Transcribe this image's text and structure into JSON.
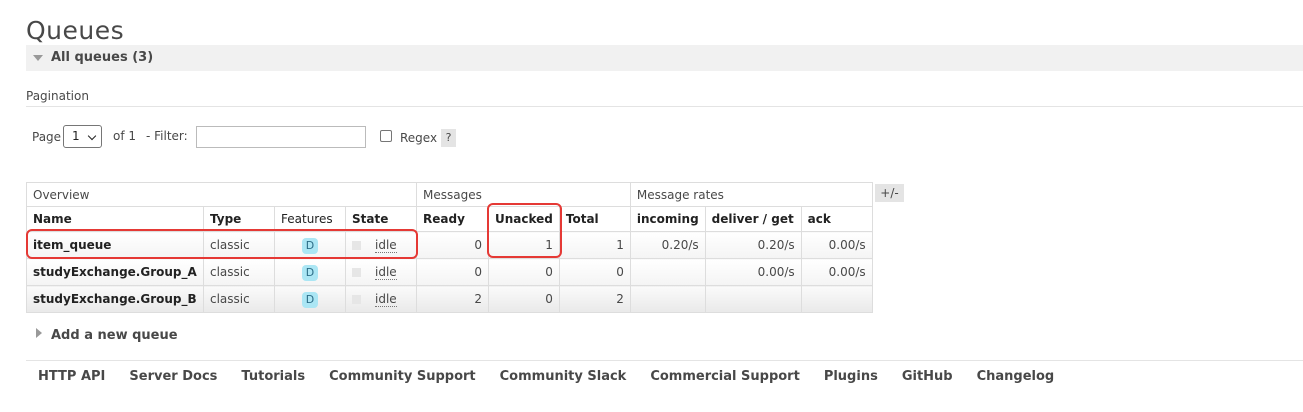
{
  "page": {
    "title": "Queues"
  },
  "section": {
    "label": "All queues (3)"
  },
  "pagination": {
    "label": "Pagination",
    "page_label": "Page",
    "page_value": "1",
    "of_label": "of 1",
    "filter_label": "- Filter:",
    "filter_value": "",
    "regex_label": "Regex",
    "help_label": "?"
  },
  "table": {
    "groups": {
      "overview": "Overview",
      "messages": "Messages",
      "rates": "Message rates"
    },
    "columns": {
      "name": "Name",
      "type": "Type",
      "features": "Features",
      "state": "State",
      "ready": "Ready",
      "unacked": "Unacked",
      "total": "Total",
      "incoming": "incoming",
      "deliver": "deliver / get",
      "ack": "ack"
    },
    "toggle": "+/-",
    "rows": [
      {
        "name": "item_queue",
        "type": "classic",
        "feature": "D",
        "state": "idle",
        "ready": "0",
        "unacked": "1",
        "total": "1",
        "incoming": "0.20/s",
        "deliver": "0.20/s",
        "ack": "0.00/s"
      },
      {
        "name": "studyExchange.Group_A",
        "type": "classic",
        "feature": "D",
        "state": "idle",
        "ready": "0",
        "unacked": "0",
        "total": "0",
        "incoming": "",
        "deliver": "0.00/s",
        "ack": "0.00/s"
      },
      {
        "name": "studyExchange.Group_B",
        "type": "classic",
        "feature": "D",
        "state": "idle",
        "ready": "2",
        "unacked": "0",
        "total": "2",
        "incoming": "",
        "deliver": "",
        "ack": ""
      }
    ]
  },
  "add_queue": {
    "label": "Add a new queue"
  },
  "footer": {
    "links": [
      "HTTP API",
      "Server Docs",
      "Tutorials",
      "Community Support",
      "Community Slack",
      "Commercial Support",
      "Plugins",
      "GitHub",
      "Changelog"
    ]
  },
  "colors": {
    "highlight": "#e53935",
    "badge_bg": "#abe6f4"
  }
}
